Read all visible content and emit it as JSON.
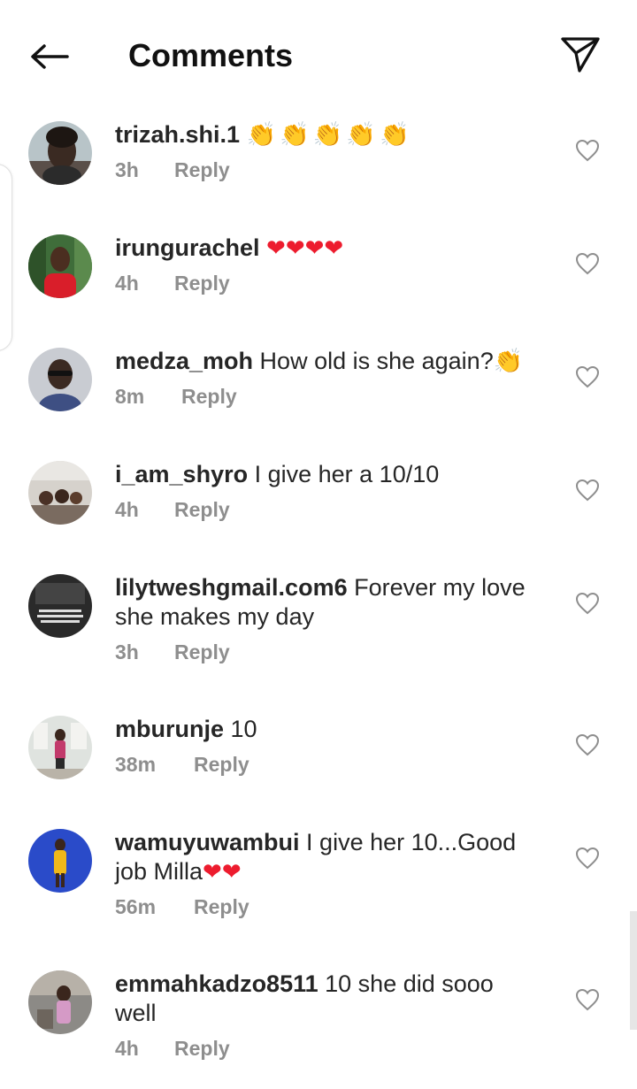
{
  "header": {
    "title": "Comments",
    "back_icon": "arrow-left-icon",
    "send_icon": "paper-plane-icon"
  },
  "colors": {
    "text": "#262626",
    "meta": "#8e8e8e",
    "heart": "#ed1c2e",
    "clap": "#f5b400"
  },
  "comments": [
    {
      "username": "trizah.shi.1",
      "text": "",
      "emoji": "👏👏👏👏👏",
      "time": "3h",
      "reply": "Reply"
    },
    {
      "username": "irungurachel",
      "text": "",
      "emoji": "❤❤❤❤",
      "time": "4h",
      "reply": "Reply"
    },
    {
      "username": "medza_moh",
      "text": " How old is she again?",
      "emoji": "👏",
      "time": "8m",
      "reply": "Reply"
    },
    {
      "username": "i_am_shyro",
      "text": " I give her a 10/10",
      "emoji": "",
      "time": "4h",
      "reply": "Reply"
    },
    {
      "username": "lilytweshgmail.com6",
      "text": " Forever my love she makes my day",
      "emoji": "",
      "time": "3h",
      "reply": "Reply"
    },
    {
      "username": "mburunje",
      "text": " 10",
      "emoji": "",
      "time": "38m",
      "reply": "Reply"
    },
    {
      "username": "wamuyuwambui",
      "text": " I give her 10...Good job Milla",
      "emoji": "❤❤",
      "time": "56m",
      "reply": "Reply"
    },
    {
      "username": "emmahkadzo8511",
      "text": " 10 she did sooo well",
      "emoji": "",
      "time": "4h",
      "reply": "Reply"
    }
  ]
}
